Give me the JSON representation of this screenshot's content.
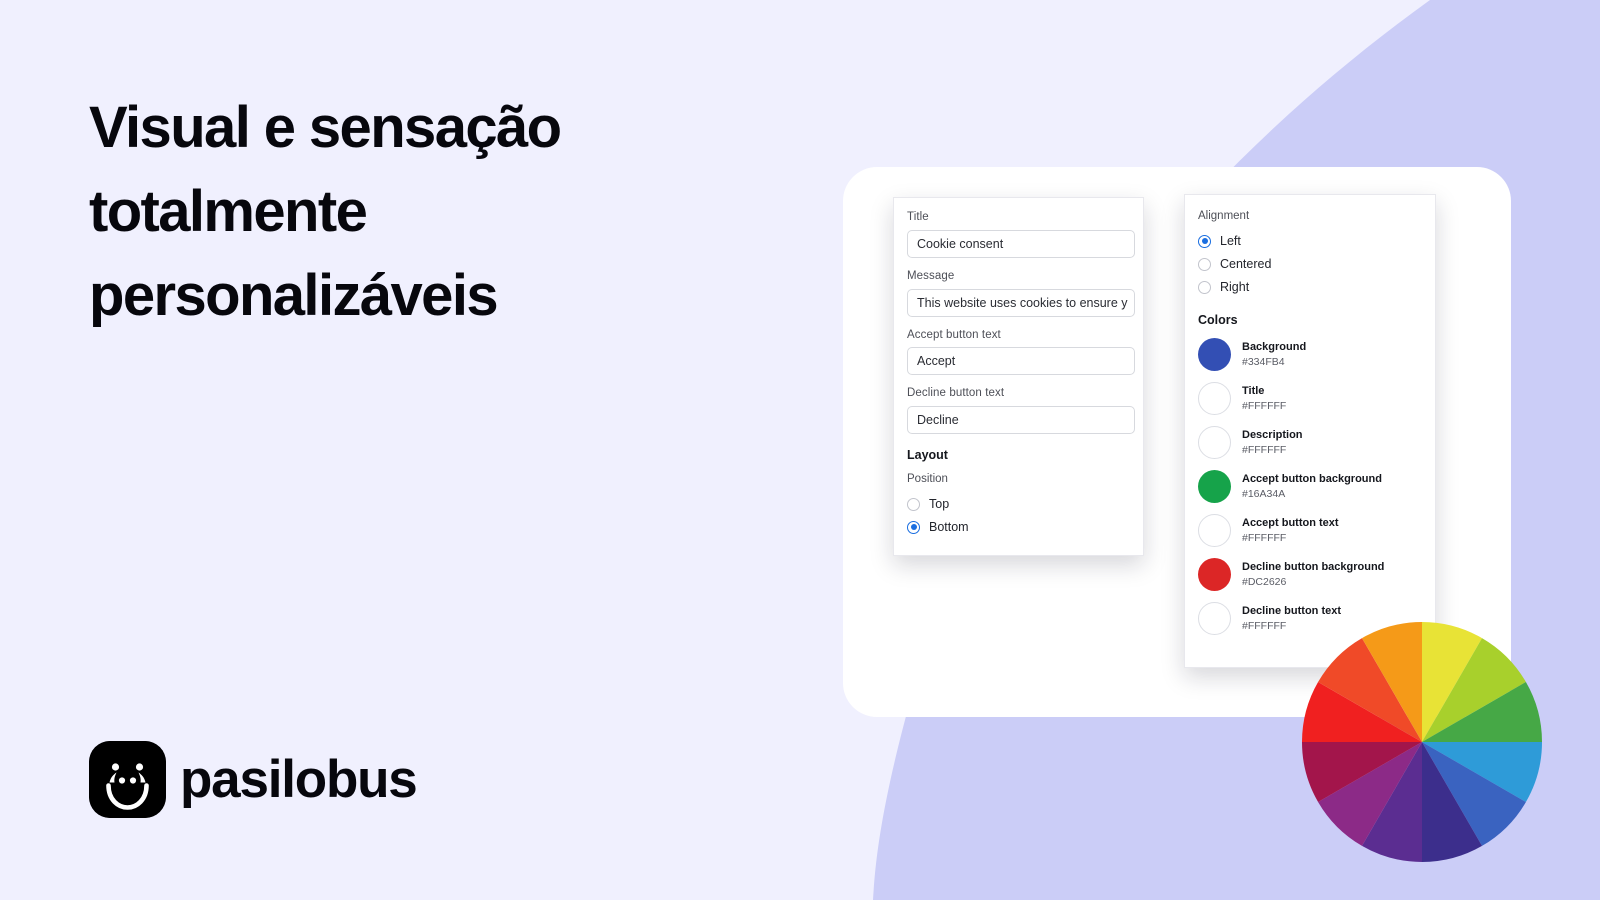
{
  "page": {
    "headline": "Visual e sensação totalmente personalizáveis",
    "background_color": "#F0F0FE",
    "accent_shape_color": "#CBCDF7"
  },
  "brand": {
    "name": "pasilobus",
    "mark_icon": "smiley-face-icon",
    "mark_color": "#000000"
  },
  "settings_panel": {
    "fields": [
      {
        "label": "Title",
        "value": "Cookie consent"
      },
      {
        "label": "Message",
        "value": "This website uses cookies to ensure y"
      },
      {
        "label": "Accept button text",
        "value": "Accept"
      },
      {
        "label": "Decline button text",
        "value": "Decline"
      }
    ],
    "layout": {
      "heading": "Layout",
      "position_label": "Position",
      "options": [
        {
          "label": "Top",
          "selected": false
        },
        {
          "label": "Bottom",
          "selected": true
        }
      ]
    }
  },
  "appearance_panel": {
    "alignment": {
      "label": "Alignment",
      "options": [
        {
          "label": "Left",
          "selected": true
        },
        {
          "label": "Centered",
          "selected": false
        },
        {
          "label": "Right",
          "selected": false
        }
      ]
    },
    "colors": {
      "heading": "Colors",
      "items": [
        {
          "name": "Background",
          "hex": "#334FB4"
        },
        {
          "name": "Title",
          "hex": "#FFFFFF"
        },
        {
          "name": "Description",
          "hex": "#FFFFFF"
        },
        {
          "name": "Accept button background",
          "hex": "#16A34A"
        },
        {
          "name": "Accept button text",
          "hex": "#FFFFFF"
        },
        {
          "name": "Decline button background",
          "hex": "#DC2626"
        },
        {
          "name": "Decline button text",
          "hex": "#FFFFFF"
        }
      ]
    }
  },
  "color_wheel": {
    "icon": "color-wheel-icon",
    "segments": [
      "#E8E336",
      "#A8D02C",
      "#46A846",
      "#2E9BD8",
      "#3A63C0",
      "#3C2E8C",
      "#5B2D91",
      "#8C2A87",
      "#A3154B",
      "#F02020",
      "#F04A28",
      "#F59A18"
    ]
  }
}
